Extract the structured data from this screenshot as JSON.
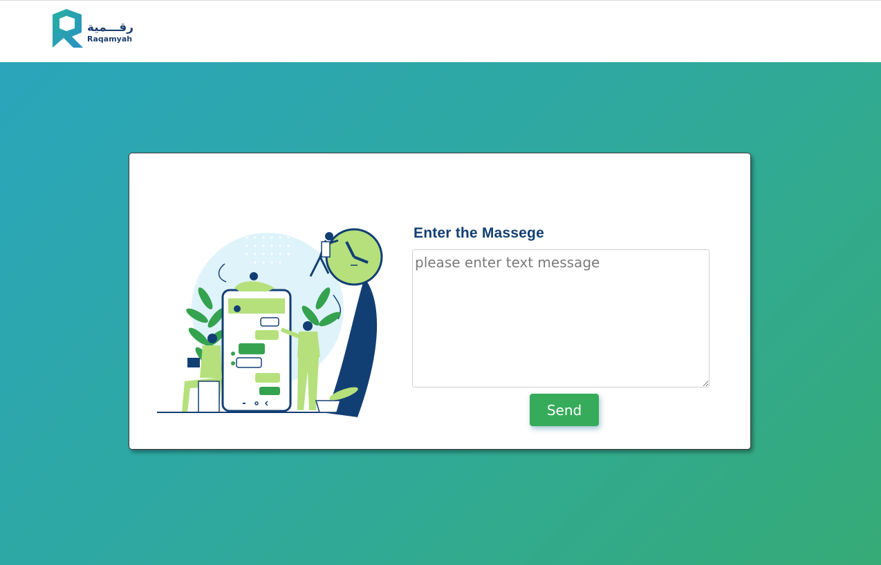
{
  "header": {
    "logo_arabic": "رقـــمية",
    "logo_latin": "Raqamyah"
  },
  "form": {
    "label": "Enter the Massege",
    "placeholder": "please enter text message",
    "value": "",
    "send_label": "Send"
  },
  "colors": {
    "brand_navy": "#123f73",
    "brand_green": "#36ab5a",
    "brand_teal": "#2aa5bb",
    "illustration_light_green": "#b5e07c",
    "illustration_light_blue": "#dff3fb"
  },
  "icons": [
    "raqamyah-logo-icon",
    "chat-illustration"
  ]
}
